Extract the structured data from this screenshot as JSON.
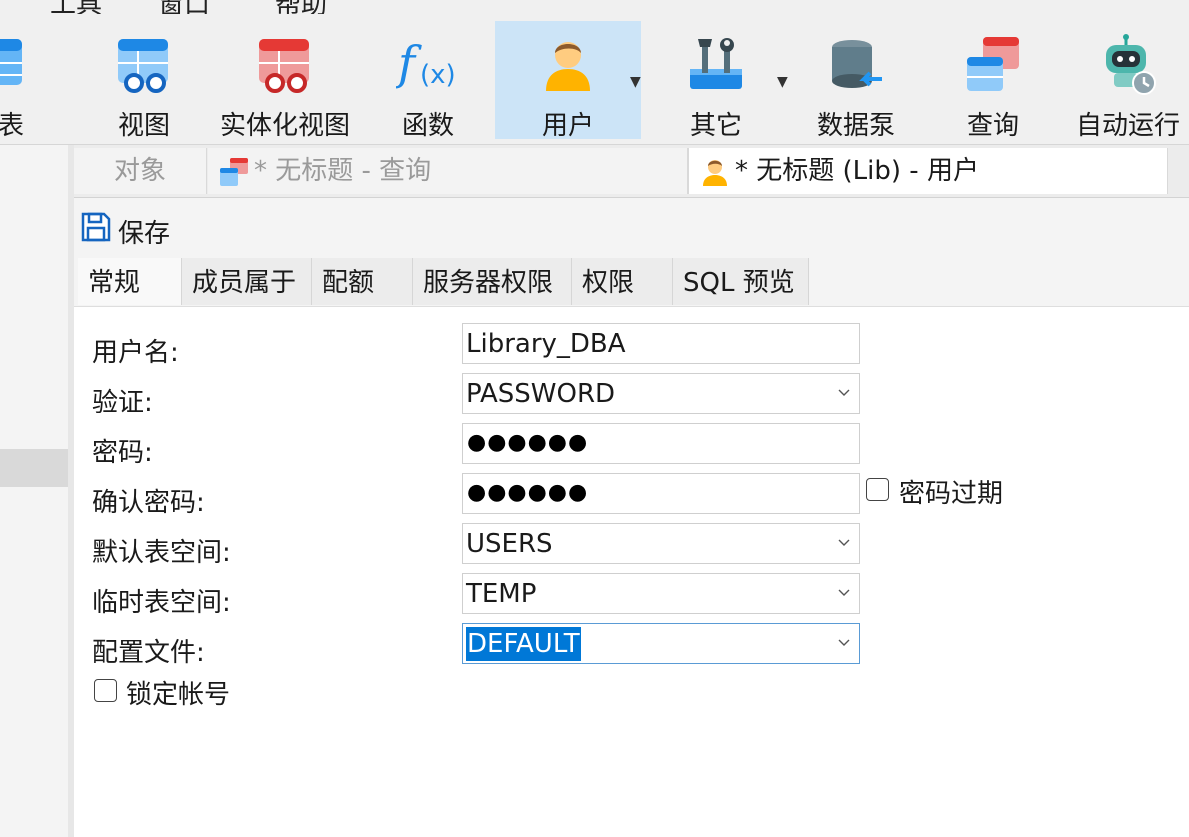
{
  "menu": {
    "items": [
      "工具",
      "窗口",
      "帮助"
    ]
  },
  "ribbon": {
    "tools": [
      {
        "id": "table",
        "label": "表"
      },
      {
        "id": "view",
        "label": "视图"
      },
      {
        "id": "mview",
        "label": "实体化视图"
      },
      {
        "id": "function",
        "label": "函数"
      },
      {
        "id": "user",
        "label": "用户"
      },
      {
        "id": "other",
        "label": "其它"
      },
      {
        "id": "datapump",
        "label": "数据泵"
      },
      {
        "id": "query",
        "label": "查询"
      },
      {
        "id": "automation",
        "label": "自动运行"
      }
    ],
    "active": "user",
    "icons": {
      "table": "table-icon",
      "view": "view-icon",
      "mview": "materialized-view-icon",
      "function": "function-icon",
      "user": "user-icon",
      "other": "tools-icon",
      "datapump": "data-pump-icon",
      "query": "query-icon",
      "automation": "robot-icon"
    },
    "colors": {
      "active_bg": "#cce4f7",
      "blue": "#1e88e5",
      "red": "#e53935"
    }
  },
  "doc_tabs": {
    "objects": "对象",
    "query_tab": "* 无标题 - 查询",
    "user_tab": "* 无标题 (Lib) - 用户"
  },
  "toolbar": {
    "save_label": "保存"
  },
  "prop_tabs": [
    "常规",
    "成员属于",
    "配额",
    "服务器权限",
    "权限",
    "SQL 预览"
  ],
  "form": {
    "username_label": "用户名:",
    "username_value": "Library_DBA",
    "auth_label": "验证:",
    "auth_value": "PASSWORD",
    "password_label": "密码:",
    "password_value": "●●●●●●",
    "confirm_label": "确认密码:",
    "confirm_value": "●●●●●●",
    "password_expired_label": "密码过期",
    "password_expired_checked": false,
    "default_ts_label": "默认表空间:",
    "default_ts_value": "USERS",
    "temp_ts_label": "临时表空间:",
    "temp_ts_value": "TEMP",
    "profile_label": "配置文件:",
    "profile_value": "DEFAULT",
    "lock_account_label": "锁定帐号",
    "lock_account_checked": false
  }
}
